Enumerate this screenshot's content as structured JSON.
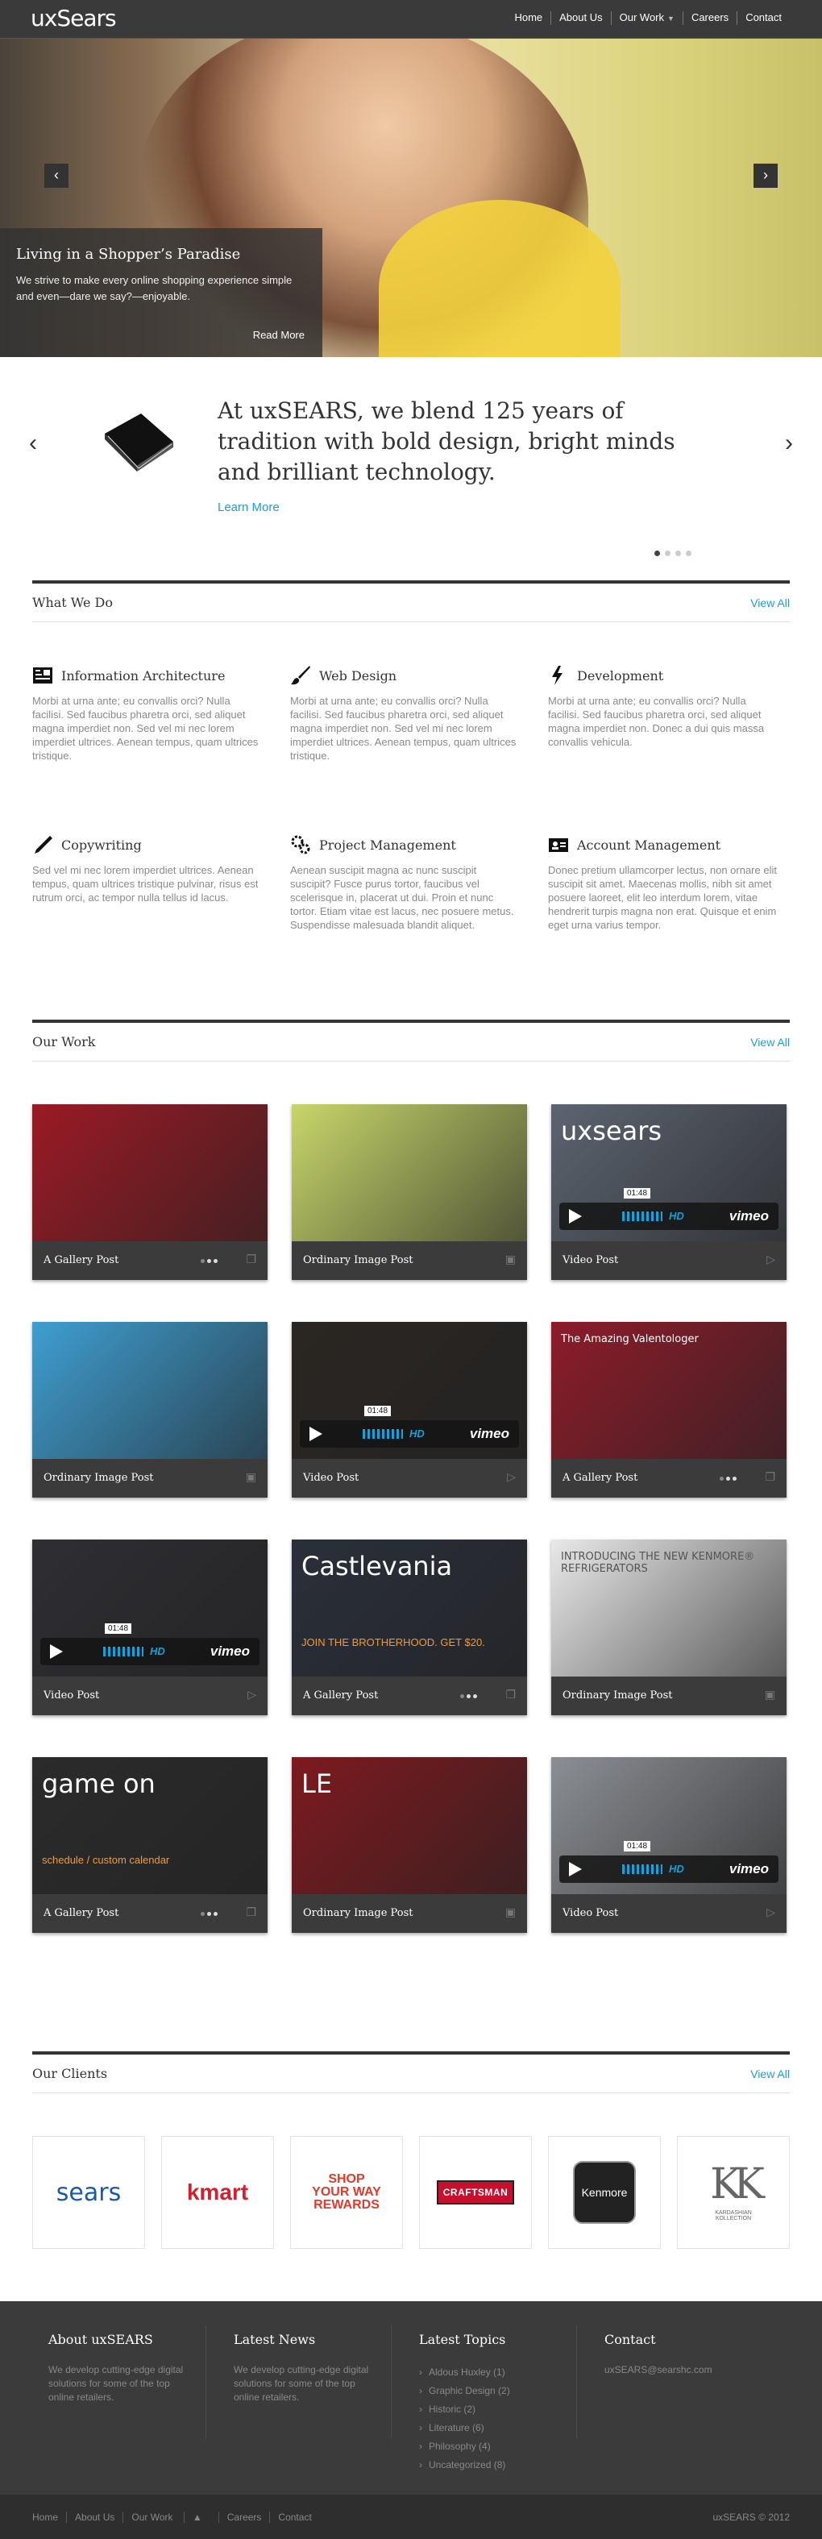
{
  "header": {
    "logo": "uxSears",
    "nav": [
      "Home",
      "About Us",
      "Our Work",
      "Careers",
      "Contact"
    ]
  },
  "hero": {
    "title": "Living in a Shopper’s Paradise",
    "text": "We strive to make every online shopping experience simple and even—dare we say?—enjoyable.",
    "read_more": "Read More",
    "prev": "‹",
    "next": "›"
  },
  "intro": {
    "heading": "At uxSEARS, we blend 125 years of tradition with bold design, bright minds and brilliant technology.",
    "link": "Learn More",
    "slides": 4,
    "active_slide": 1
  },
  "what_we_do": {
    "title": "What We Do",
    "view_all": "View All",
    "services": [
      {
        "icon": "ia-icon",
        "title": "Information Architecture",
        "text": "Morbi at urna ante; eu convallis orci? Nulla facilisi. Sed faucibus pharetra orci, sed aliquet magna imperdiet non. Sed vel mi nec lorem imperdiet ultrices. Aenean tempus, quam ultrices tristique."
      },
      {
        "icon": "brush-icon",
        "title": "Web Design",
        "text": "Morbi at urna ante; eu convallis orci? Nulla facilisi. Sed faucibus pharetra orci, sed aliquet magna imperdiet non. Sed vel mi nec lorem imperdiet ultrices. Aenean tempus, quam ultrices tristique."
      },
      {
        "icon": "lightning-icon",
        "title": "Development",
        "text": "Morbi at urna ante; eu convallis orci? Nulla facilisi. Sed faucibus pharetra orci, sed aliquet magna imperdiet non. Donec a dui quis massa convallis vehicula."
      },
      {
        "icon": "pen-icon",
        "title": "Copywriting",
        "text": "Sed vel mi nec lorem imperdiet ultrices. Aenean tempus, quam ultrices tristique pulvinar, risus est rutrum orci, ac tempor nulla tellus id lacus."
      },
      {
        "icon": "gears-icon",
        "title": "Project Management",
        "text": "Aenean suscipit magna ac nunc suscipit suscipit? Fusce purus tortor, faucibus vel scelerisque in, placerat ut dui. Proin et nunc tortor. Etiam vitae est lacus, nec posuere metus. Suspendisse malesuada blandit aliquet."
      },
      {
        "icon": "account-icon",
        "title": "Account Management",
        "text": "Donec pretium ullamcorper lectus, non ornare elit suscipit sit amet. Maecenas mollis, nibh sit amet posuere laoreet, elit leo interdum lorem, vitae hendrerit turpis magna non erat. Quisque et enim eget urna varius tempor."
      }
    ]
  },
  "our_work": {
    "title": "Our Work",
    "view_all": "View All",
    "items": [
      {
        "label": "A Gallery Post",
        "kind": "gallery",
        "bg": "#9b1a24"
      },
      {
        "label": "Ordinary Image Post",
        "kind": "image",
        "bg": "#c8d66a"
      },
      {
        "label": "Video Post",
        "kind": "video",
        "bg": "#5c6470",
        "overlay": "uxsears",
        "time": "01:48"
      },
      {
        "label": "Ordinary Image Post",
        "kind": "image",
        "bg": "#3f9ed1"
      },
      {
        "label": "Video Post",
        "kind": "video",
        "bg": "#2a2622",
        "time": "01:48"
      },
      {
        "label": "A Gallery Post",
        "kind": "gallery",
        "bg": "#8d1c2a",
        "overlay": "The Amazing Valentologer"
      },
      {
        "label": "Video Post",
        "kind": "video",
        "bg": "#2e2e33",
        "time": "01:48"
      },
      {
        "label": "A Gallery Post",
        "kind": "gallery",
        "bg": "#2a2f3a",
        "overlay": "Castlevania",
        "overlay2": "JOIN THE BROTHERHOOD. GET $20."
      },
      {
        "label": "Ordinary Image Post",
        "kind": "image",
        "bg": "#e9e9e9",
        "overlay": "INTRODUCING THE NEW KENMORE® REFRIGERATORS"
      },
      {
        "label": "A Gallery Post",
        "kind": "gallery",
        "bg": "#2b2b2b",
        "overlay": "game on",
        "overlay2": "schedule / custom calendar"
      },
      {
        "label": "Ordinary Image Post",
        "kind": "image",
        "bg": "#7d1a1f",
        "overlay": "LE"
      },
      {
        "label": "Video Post",
        "kind": "video",
        "bg": "#8b8e93",
        "time": "01:48"
      }
    ]
  },
  "clients": {
    "title": "Our Clients",
    "view_all": "View All",
    "logos": [
      {
        "name": "sears",
        "color": "#1a5ba8"
      },
      {
        "name": "kmart",
        "color": "#d3202e"
      },
      {
        "name": "SHOP YOUR WAY REWARDS",
        "color": "#e23a2b"
      },
      {
        "name": "CRAFTSMAN",
        "color": "#c8102e"
      },
      {
        "name": "Kenmore",
        "color": "#222222"
      },
      {
        "name": "KARDASHIAN KOLLECTION",
        "color": "#666666"
      }
    ]
  },
  "footer": {
    "about": {
      "title": "About uxSEARS",
      "text": "We develop cutting-edge digital solutions for some of the top online retailers."
    },
    "news": {
      "title": "Latest News",
      "text": "We develop cutting-edge digital solutions for some of the top online retailers."
    },
    "topics": {
      "title": "Latest Topics",
      "items": [
        "Aldous Huxley (1)",
        "Graphic Design (2)",
        "Historic (2)",
        "Literature (6)",
        "Philosophy (4)",
        "Uncategorized (8)"
      ]
    },
    "contact": {
      "title": "Contact",
      "email": "uxSEARS@searshc.com"
    },
    "nav": [
      "Home",
      "About Us",
      "Our Work",
      "Careers",
      "Contact"
    ],
    "copyright": "uxSEARS © 2012"
  }
}
